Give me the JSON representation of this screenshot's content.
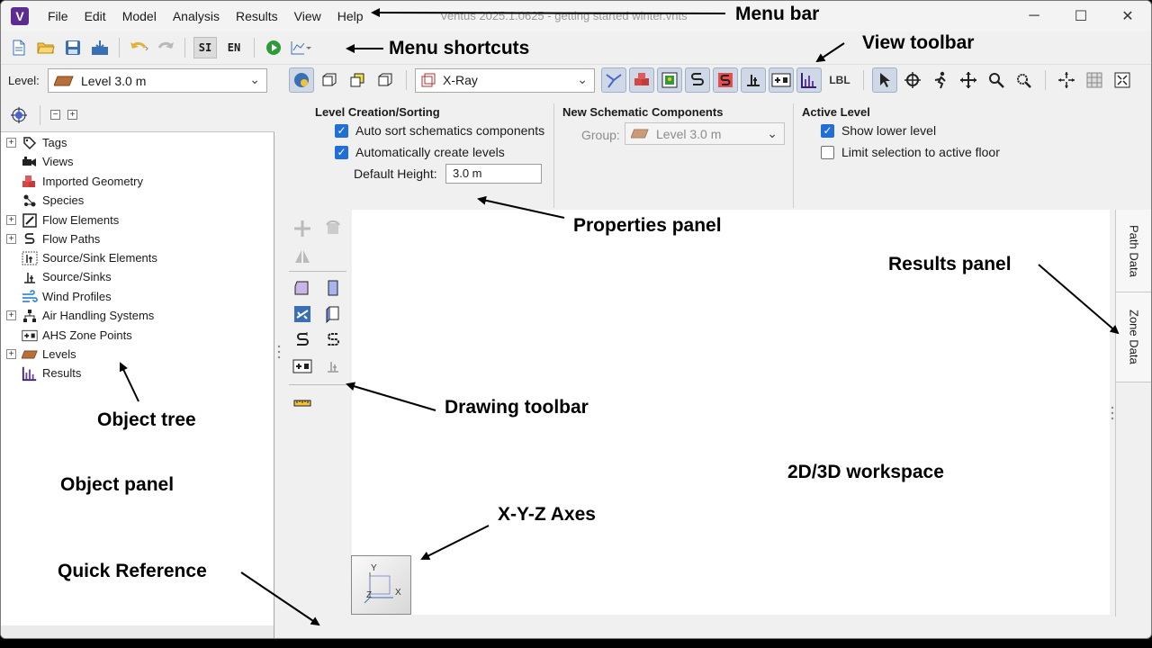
{
  "app": {
    "logo_letter": "V",
    "title": "Ventus 2025.1.0625 - getting started winter.vnts",
    "colors": {
      "brand": "#5c2d91",
      "accent": "#1f6fd6"
    }
  },
  "menu": [
    "File",
    "Edit",
    "Model",
    "Analysis",
    "Results",
    "View",
    "Help"
  ],
  "window_controls": {
    "minimize": "─",
    "maximize": "☐",
    "close": "✕"
  },
  "shortcuts": {
    "icons": [
      "new-file-icon",
      "open-folder-icon",
      "save-icon",
      "export-icon",
      "undo-icon",
      "redo-icon"
    ],
    "unit_si": "SI",
    "unit_en": "EN",
    "run_icon": "play-icon",
    "chart_icon": "chart-icon"
  },
  "level": {
    "label": "Level:",
    "selected": "Level 3.0 m"
  },
  "view_mode": {
    "selected": "X-Ray"
  },
  "view_toolbar": {
    "lbl_label": "LBL"
  },
  "tree_toolbar": {
    "collapse": "−",
    "expand": "+"
  },
  "object_tree": [
    {
      "label": "Tags",
      "expandable": true,
      "icon": "tag-icon"
    },
    {
      "label": "Views",
      "expandable": false,
      "icon": "camera-icon"
    },
    {
      "label": "Imported Geometry",
      "expandable": false,
      "icon": "geometry-icon"
    },
    {
      "label": "Species",
      "expandable": false,
      "icon": "species-icon"
    },
    {
      "label": "Flow Elements",
      "expandable": true,
      "icon": "flow-element-icon"
    },
    {
      "label": "Flow Paths",
      "expandable": true,
      "icon": "flow-path-icon"
    },
    {
      "label": "Source/Sink Elements",
      "expandable": false,
      "icon": "source-sink-element-icon"
    },
    {
      "label": "Source/Sinks",
      "expandable": false,
      "icon": "source-sink-icon"
    },
    {
      "label": "Wind Profiles",
      "expandable": false,
      "icon": "wind-icon"
    },
    {
      "label": "Air Handling Systems",
      "expandable": true,
      "icon": "ahs-icon"
    },
    {
      "label": "AHS Zone Points",
      "expandable": false,
      "icon": "ahs-zone-point-icon"
    },
    {
      "label": "Levels",
      "expandable": true,
      "icon": "level-icon"
    },
    {
      "label": "Results",
      "expandable": false,
      "icon": "results-icon"
    }
  ],
  "properties": {
    "level_creation": {
      "title": "Level Creation/Sorting",
      "auto_sort": {
        "label": "Auto sort schematics components",
        "checked": true
      },
      "auto_create": {
        "label": "Automatically create levels",
        "checked": true
      },
      "default_height_label": "Default Height:",
      "default_height_value": "3.0 m"
    },
    "new_schematic": {
      "title": "New Schematic Components",
      "group_label": "Group:",
      "group_value": "Level 3.0 m"
    },
    "active_level": {
      "title": "Active Level",
      "show_lower": {
        "label": "Show lower level",
        "checked": true
      },
      "limit_selection": {
        "label": "Limit selection to active floor",
        "checked": false
      }
    }
  },
  "results_tabs": [
    "Path Data",
    "Zone Data"
  ],
  "axes": {
    "x": "X",
    "y": "Y",
    "z": "Z"
  },
  "annotations": {
    "menu_bar": "Menu bar",
    "menu_shortcuts": "Menu shortcuts",
    "view_toolbar": "View toolbar",
    "properties_panel": "Properties panel",
    "results_panel": "Results panel",
    "drawing_toolbar": "Drawing toolbar",
    "object_tree": "Object tree",
    "object_panel": "Object panel",
    "workspace": "2D/3D workspace",
    "axes": "X-Y-Z Axes",
    "quick_reference": "Quick Reference"
  }
}
